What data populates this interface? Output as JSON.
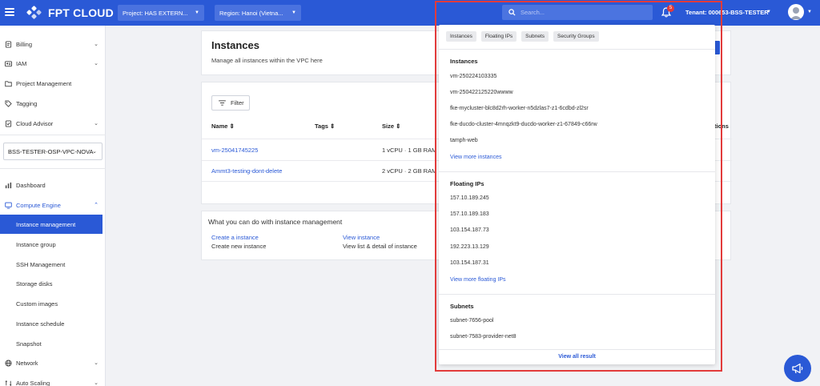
{
  "brand": {
    "logo_text": "FPT CLOUD"
  },
  "topbar": {
    "project_label": "Project: HAS EXTERN...",
    "region_label": "Region: Hanoi (Vietna...",
    "search_placeholder": "Search...",
    "notification_count": "5",
    "tenant_label": "Tenant: 000653-BSS-TESTER"
  },
  "sidebar": {
    "top_items": [
      {
        "label": "Billing",
        "icon": "billing-icon",
        "has_chevron": true
      },
      {
        "label": "IAM",
        "icon": "id-card-icon",
        "has_chevron": true
      },
      {
        "label": "Project Management",
        "icon": "folder-icon",
        "has_chevron": false
      },
      {
        "label": "Tagging",
        "icon": "tag-icon",
        "has_chevron": false
      },
      {
        "label": "Cloud Advisor",
        "icon": "advisor-icon",
        "has_chevron": true
      }
    ],
    "vpc_select": "BSS-TESTER-OSP-VPC-NOVA",
    "dashboard": "Dashboard",
    "compute_engine": "Compute Engine",
    "compute_items": [
      "Instance management",
      "Instance group",
      "SSH Management",
      "Storage disks",
      "Custom images",
      "Instance schedule",
      "Snapshot"
    ],
    "network": "Network",
    "auto_scaling": "Auto Scaling"
  },
  "header": {
    "title": "Instances",
    "subtitle": "Manage all instances within the VPC here"
  },
  "table": {
    "filter_label": "Filter",
    "columns": [
      "Name",
      "Tags",
      "Size",
      "tions"
    ],
    "rows": [
      {
        "name": "vm-25041745225",
        "size": "1 vCPU · 1 GB RAM"
      },
      {
        "name": "Ammt3-testing-dont-delete",
        "size": "2 vCPU · 2 GB RAM"
      }
    ]
  },
  "help": {
    "title": "What you can do with instance management",
    "actions": [
      {
        "link": "Create a instance",
        "desc": "Create new instance"
      },
      {
        "link": "View instance",
        "desc": "View list & detail of instance"
      }
    ]
  },
  "search_results": {
    "chips": [
      "Instances",
      "Floating IPs",
      "Subnets",
      "Security Groups"
    ],
    "instances_heading": "Instances",
    "instances": [
      "vm-250224103335",
      "vm-250422125220wwww",
      "fke-mycluster-blc8d2rh-worker-n5dzlas7-z1-6cdbd-zl2sr",
      "fke-ducdo-cluster-4mnqzkt9-ducdo-worker-z1-67849-c66rw",
      "tamph-web"
    ],
    "view_more_instances": "View more instances",
    "floating_heading": "Floating IPs",
    "floating_ips": [
      "157.10.189.245",
      "157.10.189.183",
      "103.154.187.73",
      "192.223.13.129",
      "103.154.187.31"
    ],
    "view_more_floating": "View more floating IPs",
    "subnets_heading": "Subnets",
    "subnets": [
      "subnet-7656-pool",
      "subnet-7583-provider-net8"
    ],
    "view_all": "View all result"
  },
  "colors": {
    "primary": "#2a59d6",
    "highlight": "#e23b3b",
    "badge": "#e23a3a"
  }
}
